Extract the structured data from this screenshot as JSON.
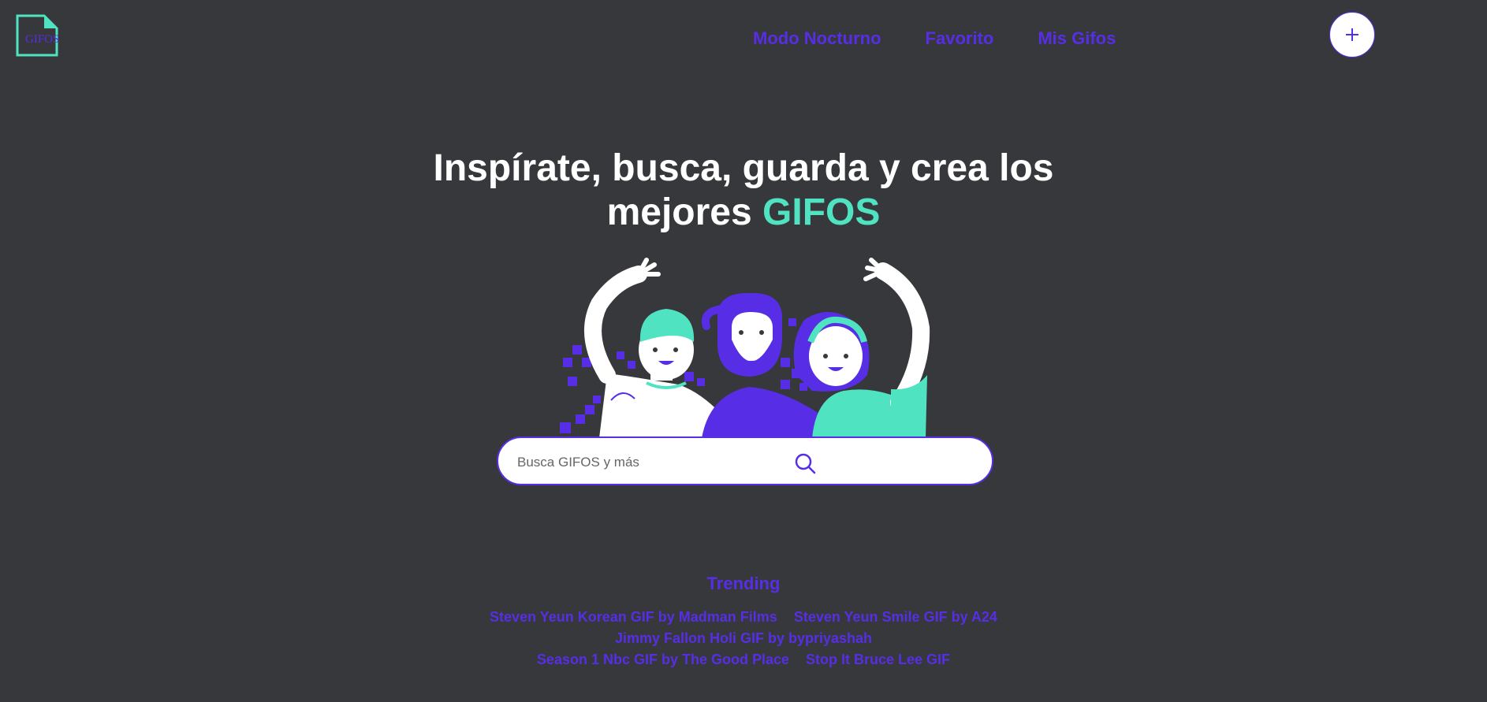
{
  "header": {
    "logo_text": "GIFOS",
    "nav": [
      {
        "label": "Modo Nocturno"
      },
      {
        "label": "Favorito"
      },
      {
        "label": "Mis Gifos"
      }
    ],
    "add_icon": "plus-icon"
  },
  "hero": {
    "title_line1": "Inspírate, busca, guarda y crea los",
    "title_line2_prefix": "mejores",
    "title_line2_accent": "GIFOS",
    "illustration": "people-waving-illustration"
  },
  "search": {
    "placeholder": "Busca GIFOS y más",
    "value": "",
    "icon": "search-icon"
  },
  "trending": {
    "title": "Trending",
    "items": [
      "Steven Yeun Korean GIF by Madman Films",
      "Steven Yeun Smile GIF by A24",
      "Jimmy Fallon Holi GIF by bypriyashah",
      "Season 1 Nbc GIF by The Good Place",
      "Stop It Bruce Lee GIF"
    ]
  },
  "colors": {
    "background": "#37383c",
    "accent_purple": "#572ee5",
    "accent_green": "#50e3c2",
    "text_white": "#ffffff"
  }
}
